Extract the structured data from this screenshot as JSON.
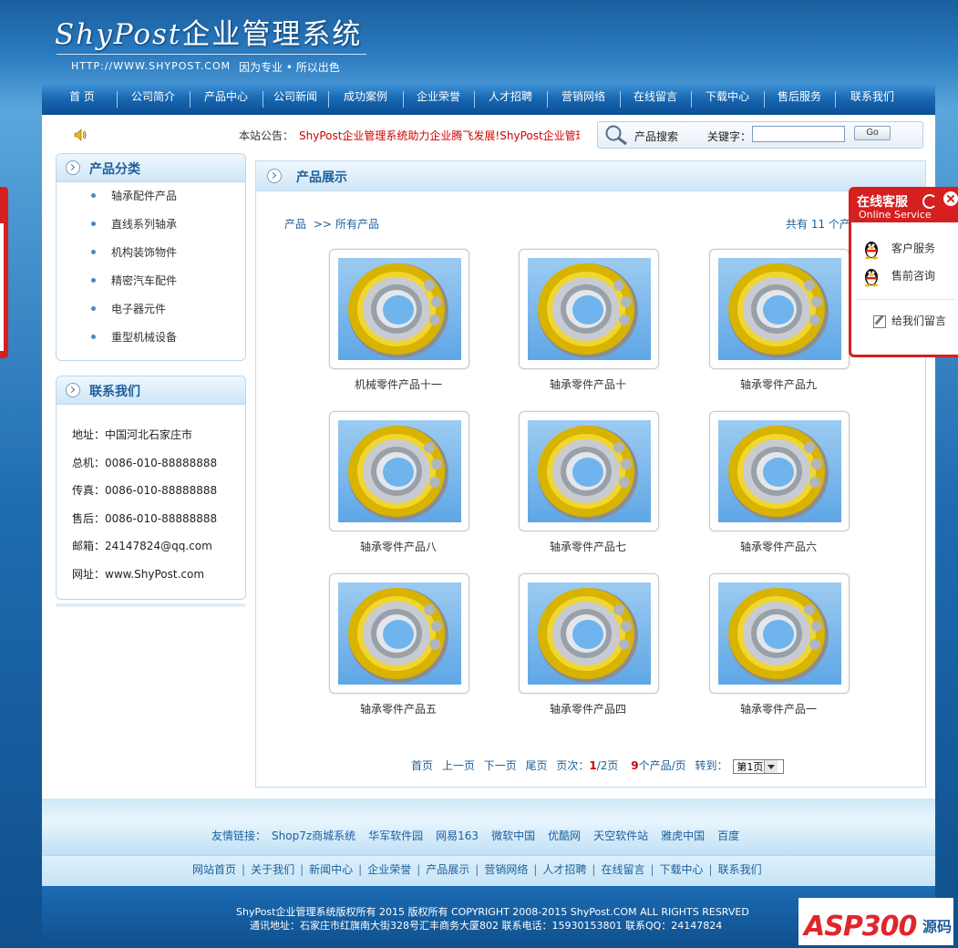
{
  "header": {
    "logo_en": "ShyPost",
    "logo_cn": "企业管理系统",
    "url": "HTTP://WWW.SHYPOST.COM",
    "slogan": "因为专业 • 所以出色"
  },
  "nav": {
    "items": [
      "首 页",
      "公司简介",
      "产品中心",
      "公司新闻",
      "成功案例",
      "企业荣誉",
      "人才招聘",
      "营销网络",
      "在线留言",
      "下载中心",
      "售后服务",
      "联系我们"
    ]
  },
  "notice": {
    "label": "本站公告：",
    "text": "ShyPost企业管理系统助力企业腾飞发展!ShyPost企业管理"
  },
  "search": {
    "title": "产品搜索",
    "keyword_label": "关键字：",
    "value": "",
    "placeholder": "",
    "button": "Go"
  },
  "categories": {
    "title": "产品分类",
    "items": [
      "轴承配件产品",
      "直线系列轴承",
      "机构装饰物件",
      "精密汽车配件",
      "电子器元件",
      "重型机械设备"
    ]
  },
  "contact": {
    "title": "联系我们",
    "items": [
      "地址：中国河北石家庄市",
      "总机：0086-010-88888888",
      "传真：0086-010-88888888",
      "售后：0086-010-88888888",
      "邮箱：24147824@qq.com",
      "网址：www.ShyPost.com"
    ]
  },
  "main": {
    "title": "产品展示",
    "crumb_root": "产品",
    "crumb_sep": ">>",
    "crumb_current": "所有产品",
    "total": "共有 11 个产"
  },
  "products": [
    "机械零件产品十一",
    "轴承零件产品十",
    "轴承零件产品九",
    "轴承零件产品八",
    "轴承零件产品七",
    "轴承零件产品六",
    "轴承零件产品五",
    "轴承零件产品四",
    "轴承零件产品一"
  ],
  "pager": {
    "first": "首页",
    "prev": "上一页",
    "next": "下一页",
    "last": "尾页",
    "page_label": "页次：",
    "current": "1",
    "total": "/2页",
    "per_page_num": "9",
    "per_page_text": "个产品/页",
    "goto": "转到：",
    "select": "第1页"
  },
  "friend_links": {
    "label": "友情链接：",
    "items": [
      "Shop7z商城系统",
      "华军软件园",
      "网易163",
      "微软中国",
      "优酷网",
      "天空软件站",
      "雅虎中国",
      "百度"
    ]
  },
  "foot_nav": {
    "items": [
      "网站首页",
      "关于我们",
      "新闻中心",
      "企业荣誉",
      "产品展示",
      "营销网络",
      "人才招聘",
      "在线留言",
      "下载中心",
      "联系我们"
    ],
    "sep": "|"
  },
  "copyright": {
    "line1": "ShyPost企业管理系统版权所有 2015 版权所有 COPYRIGHT 2008-2015 ShyPost.COM ALL RIGHTS RESRVED",
    "line2": "通讯地址：石家庄市红旗南大街328号汇丰商务大厦802 联系电话：15930153801 联系QQ：24147824"
  },
  "online_service": {
    "title": "在线客服",
    "subtitle": "Online Service",
    "items": [
      "客户服务",
      "售前咨询"
    ],
    "message": "给我们留言"
  },
  "watermark": {
    "text": "ASP300",
    "suffix": "源码"
  },
  "colors": {
    "accent": "#1d5f9b",
    "notice": "#d40000",
    "service_red": "#d61f1f"
  }
}
